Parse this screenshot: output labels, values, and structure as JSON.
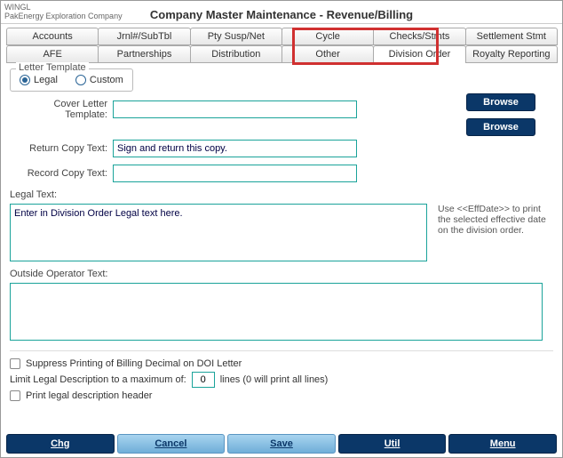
{
  "header": {
    "app_name": "WINGL",
    "company_name": "PakEnergy Exploration Company",
    "title": "Company Master Maintenance -    Revenue/Billing"
  },
  "tabs": {
    "row1": [
      "Accounts",
      "Jrnl#/SubTbl",
      "Pty Susp/Net",
      "Cycle",
      "Checks/Stmts",
      "Settlement Stmt"
    ],
    "row2": [
      "AFE",
      "Partnerships",
      "Distribution",
      "Other",
      "Division Order",
      "Royalty Reporting"
    ]
  },
  "letter_template": {
    "legend": "Letter Template",
    "opt_legal": "Legal",
    "opt_custom": "Custom"
  },
  "fields": {
    "cover_letter_label": "Cover Letter Template:",
    "cover_letter_value": "",
    "return_copy_label": "Return Copy Text:",
    "return_copy_value": "Sign and return this copy.",
    "record_copy_label": "Record Copy Text:",
    "record_copy_value": ""
  },
  "browse": "Browse",
  "legal_text": {
    "label": "Legal Text:",
    "value": "Enter in Division Order Legal text here.",
    "hint": "Use <<EffDate>> to print the selected effective date on the division order."
  },
  "outside_operator": {
    "label": "Outside Operator Text:",
    "value": ""
  },
  "checks": {
    "suppress": "Suppress Printing of Billing Decimal on DOI Letter",
    "limit_pre": "Limit Legal Description to a maximum of:",
    "limit_value": "0",
    "limit_post": "lines  (0 will print all lines)",
    "print_header": "Print legal description header"
  },
  "buttons": {
    "chg": "Chg",
    "cancel": "Cancel",
    "save": "Save",
    "util": "Util",
    "menu": "Menu"
  }
}
